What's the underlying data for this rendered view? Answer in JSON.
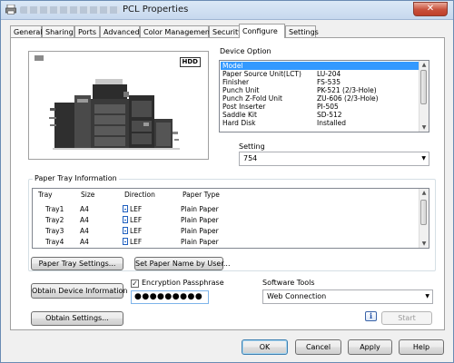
{
  "window": {
    "title": "PCL Properties",
    "close_label": "✕"
  },
  "tabs": [
    {
      "label": "General"
    },
    {
      "label": "Sharing"
    },
    {
      "label": "Ports"
    },
    {
      "label": "Advanced"
    },
    {
      "label": "Color Management"
    },
    {
      "label": "Security"
    },
    {
      "label": "Configure",
      "active": true
    },
    {
      "label": "Settings"
    }
  ],
  "device_image": {
    "hdd_badge": "HDD"
  },
  "device_option": {
    "label": "Device Option",
    "items": [
      {
        "name": "Model",
        "value": "",
        "selected": true
      },
      {
        "name": "Paper Source Unit(LCT)",
        "value": "LU-204"
      },
      {
        "name": "Finisher",
        "value": "FS-535"
      },
      {
        "name": "Punch Unit",
        "value": "PK-521 (2/3-Hole)"
      },
      {
        "name": "Punch Z-Fold Unit",
        "value": "ZU-606 (2/3-Hole)"
      },
      {
        "name": "Post Inserter",
        "value": "PI-505"
      },
      {
        "name": "Saddle Kit",
        "value": "SD-512"
      },
      {
        "name": "Hard Disk",
        "value": "Installed"
      }
    ]
  },
  "setting": {
    "label": "Setting",
    "value": "754"
  },
  "paper_tray": {
    "label": "Paper Tray Information",
    "columns": [
      "Tray",
      "Size",
      "Direction",
      "Paper Type"
    ],
    "rows": [
      {
        "tray": "Tray1",
        "size": "A4",
        "direction": "LEF",
        "type": "Plain Paper"
      },
      {
        "tray": "Tray2",
        "size": "A4",
        "direction": "LEF",
        "type": "Plain Paper"
      },
      {
        "tray": "Tray3",
        "size": "A4",
        "direction": "LEF",
        "type": "Plain Paper"
      },
      {
        "tray": "Tray4",
        "size": "A4",
        "direction": "LEF",
        "type": "Plain Paper"
      }
    ],
    "settings_button": "Paper Tray Settings...",
    "set_name_button": "Set Paper Name by User..."
  },
  "device_info": {
    "obtain_button": "Obtain Device Information",
    "encryption_label": "Encryption Passphrase",
    "encryption_checked": true,
    "passphrase_value": "●●●●●●●●●",
    "obtain_settings_button": "Obtain Settings..."
  },
  "software_tools": {
    "label": "Software Tools",
    "selected": "Web Connection",
    "start_button": "Start",
    "info_icon": "i"
  },
  "footer": {
    "ok": "OK",
    "cancel": "Cancel",
    "apply": "Apply",
    "help": "Help"
  },
  "colors": {
    "selection": "#3399ff",
    "window_border": "#6a8bb3",
    "dialog_bg": "#f0f0f0"
  }
}
